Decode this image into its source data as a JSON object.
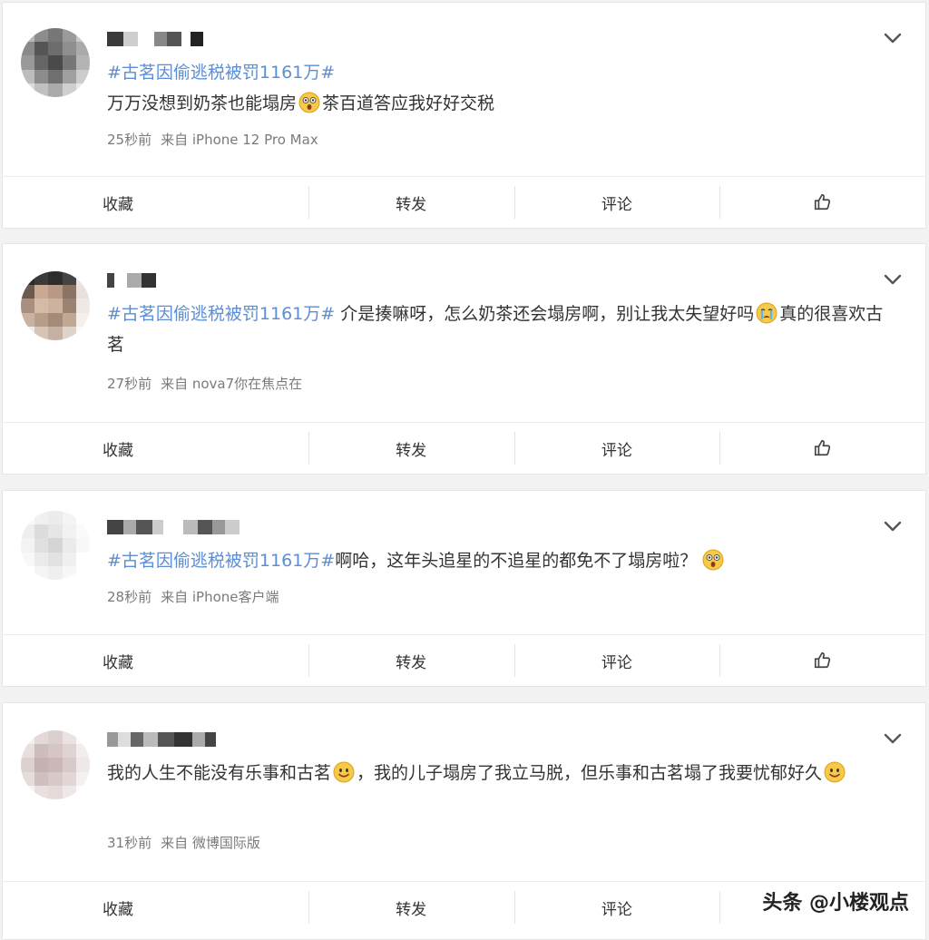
{
  "posts": [
    {
      "hashtag": "#古茗因偷逃税被罚1161万#",
      "text_a": "万万没想到奶茶也能塌房",
      "text_b": "茶百道答应我好好交税",
      "time": "25秒前",
      "source": "来自 iPhone 12 Pro Max"
    },
    {
      "hashtag": "#古茗因偷逃税被罚1161万#",
      "text_a": " 介是揍嘛呀，怎么奶茶还会塌房啊，别让我太失望好吗",
      "text_b": "真的很喜欢古茗",
      "time": "27秒前",
      "source": "来自 nova7你在焦点在"
    },
    {
      "hashtag": "#古茗因偷逃税被罚1161万#",
      "text_a": "啊哈，这年头追星的不追星的都免不了塌房啦？",
      "text_b": "",
      "time": "28秒前",
      "source": "来自 iPhone客户端"
    },
    {
      "hashtag": "",
      "text_a": "我的人生不能没有乐事和古茗",
      "text_b": "，我的儿子塌房了我立马脱，但乐事和古茗塌了我要忧郁好久",
      "time": "31秒前",
      "source": "来自 微博国际版"
    }
  ],
  "actions": {
    "favorite": "收藏",
    "repost": "转发",
    "comment": "评论"
  },
  "icons": {
    "menu": "chevron-down-icon",
    "like": "thumbs-up-icon",
    "emoji_surprised": "surprised-face-icon",
    "emoji_crying": "crying-face-icon",
    "emoji_smile": "smile-face-icon"
  },
  "colors": {
    "hashtag": "#5b8ed6",
    "text": "#333333",
    "meta": "#7a7a7a",
    "background": "#f2f2f2"
  },
  "watermark": "头条 @小楼观点"
}
